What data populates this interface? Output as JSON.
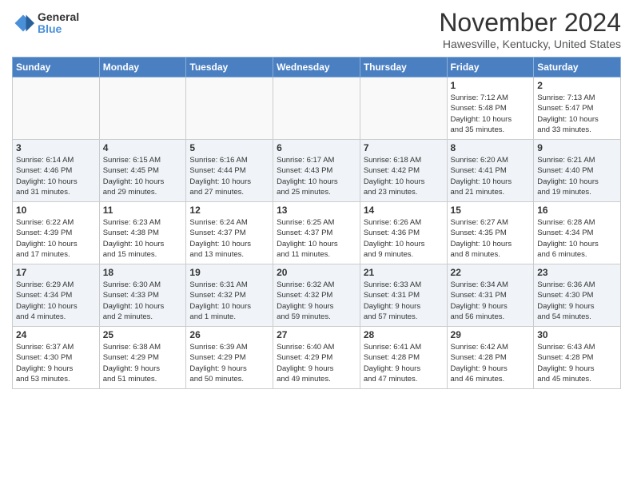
{
  "logo": {
    "general": "General",
    "blue": "Blue"
  },
  "title": "November 2024",
  "location": "Hawesville, Kentucky, United States",
  "days_of_week": [
    "Sunday",
    "Monday",
    "Tuesday",
    "Wednesday",
    "Thursday",
    "Friday",
    "Saturday"
  ],
  "weeks": [
    [
      {
        "day": "",
        "info": ""
      },
      {
        "day": "",
        "info": ""
      },
      {
        "day": "",
        "info": ""
      },
      {
        "day": "",
        "info": ""
      },
      {
        "day": "",
        "info": ""
      },
      {
        "day": "1",
        "info": "Sunrise: 7:12 AM\nSunset: 5:48 PM\nDaylight: 10 hours\nand 35 minutes."
      },
      {
        "day": "2",
        "info": "Sunrise: 7:13 AM\nSunset: 5:47 PM\nDaylight: 10 hours\nand 33 minutes."
      }
    ],
    [
      {
        "day": "3",
        "info": "Sunrise: 6:14 AM\nSunset: 4:46 PM\nDaylight: 10 hours\nand 31 minutes."
      },
      {
        "day": "4",
        "info": "Sunrise: 6:15 AM\nSunset: 4:45 PM\nDaylight: 10 hours\nand 29 minutes."
      },
      {
        "day": "5",
        "info": "Sunrise: 6:16 AM\nSunset: 4:44 PM\nDaylight: 10 hours\nand 27 minutes."
      },
      {
        "day": "6",
        "info": "Sunrise: 6:17 AM\nSunset: 4:43 PM\nDaylight: 10 hours\nand 25 minutes."
      },
      {
        "day": "7",
        "info": "Sunrise: 6:18 AM\nSunset: 4:42 PM\nDaylight: 10 hours\nand 23 minutes."
      },
      {
        "day": "8",
        "info": "Sunrise: 6:20 AM\nSunset: 4:41 PM\nDaylight: 10 hours\nand 21 minutes."
      },
      {
        "day": "9",
        "info": "Sunrise: 6:21 AM\nSunset: 4:40 PM\nDaylight: 10 hours\nand 19 minutes."
      }
    ],
    [
      {
        "day": "10",
        "info": "Sunrise: 6:22 AM\nSunset: 4:39 PM\nDaylight: 10 hours\nand 17 minutes."
      },
      {
        "day": "11",
        "info": "Sunrise: 6:23 AM\nSunset: 4:38 PM\nDaylight: 10 hours\nand 15 minutes."
      },
      {
        "day": "12",
        "info": "Sunrise: 6:24 AM\nSunset: 4:37 PM\nDaylight: 10 hours\nand 13 minutes."
      },
      {
        "day": "13",
        "info": "Sunrise: 6:25 AM\nSunset: 4:37 PM\nDaylight: 10 hours\nand 11 minutes."
      },
      {
        "day": "14",
        "info": "Sunrise: 6:26 AM\nSunset: 4:36 PM\nDaylight: 10 hours\nand 9 minutes."
      },
      {
        "day": "15",
        "info": "Sunrise: 6:27 AM\nSunset: 4:35 PM\nDaylight: 10 hours\nand 8 minutes."
      },
      {
        "day": "16",
        "info": "Sunrise: 6:28 AM\nSunset: 4:34 PM\nDaylight: 10 hours\nand 6 minutes."
      }
    ],
    [
      {
        "day": "17",
        "info": "Sunrise: 6:29 AM\nSunset: 4:34 PM\nDaylight: 10 hours\nand 4 minutes."
      },
      {
        "day": "18",
        "info": "Sunrise: 6:30 AM\nSunset: 4:33 PM\nDaylight: 10 hours\nand 2 minutes."
      },
      {
        "day": "19",
        "info": "Sunrise: 6:31 AM\nSunset: 4:32 PM\nDaylight: 10 hours\nand 1 minute."
      },
      {
        "day": "20",
        "info": "Sunrise: 6:32 AM\nSunset: 4:32 PM\nDaylight: 9 hours\nand 59 minutes."
      },
      {
        "day": "21",
        "info": "Sunrise: 6:33 AM\nSunset: 4:31 PM\nDaylight: 9 hours\nand 57 minutes."
      },
      {
        "day": "22",
        "info": "Sunrise: 6:34 AM\nSunset: 4:31 PM\nDaylight: 9 hours\nand 56 minutes."
      },
      {
        "day": "23",
        "info": "Sunrise: 6:36 AM\nSunset: 4:30 PM\nDaylight: 9 hours\nand 54 minutes."
      }
    ],
    [
      {
        "day": "24",
        "info": "Sunrise: 6:37 AM\nSunset: 4:30 PM\nDaylight: 9 hours\nand 53 minutes."
      },
      {
        "day": "25",
        "info": "Sunrise: 6:38 AM\nSunset: 4:29 PM\nDaylight: 9 hours\nand 51 minutes."
      },
      {
        "day": "26",
        "info": "Sunrise: 6:39 AM\nSunset: 4:29 PM\nDaylight: 9 hours\nand 50 minutes."
      },
      {
        "day": "27",
        "info": "Sunrise: 6:40 AM\nSunset: 4:29 PM\nDaylight: 9 hours\nand 49 minutes."
      },
      {
        "day": "28",
        "info": "Sunrise: 6:41 AM\nSunset: 4:28 PM\nDaylight: 9 hours\nand 47 minutes."
      },
      {
        "day": "29",
        "info": "Sunrise: 6:42 AM\nSunset: 4:28 PM\nDaylight: 9 hours\nand 46 minutes."
      },
      {
        "day": "30",
        "info": "Sunrise: 6:43 AM\nSunset: 4:28 PM\nDaylight: 9 hours\nand 45 minutes."
      }
    ]
  ]
}
